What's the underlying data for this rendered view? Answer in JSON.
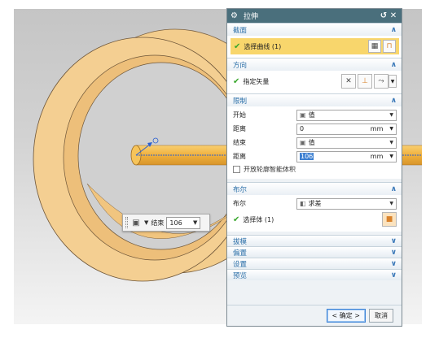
{
  "dialog": {
    "title": "拉伸",
    "sections": {
      "section": {
        "title": "截面",
        "select_curve": "选择曲线 (1)"
      },
      "direction": {
        "title": "方向",
        "specify_vector": "指定矢量"
      },
      "limits": {
        "title": "限制",
        "start_label": "开始",
        "start_type": "值",
        "start_distance_label": "距离",
        "start_distance": "0",
        "start_unit": "mm",
        "end_label": "结束",
        "end_type": "值",
        "end_distance_label": "距离",
        "end_distance": "106",
        "end_unit": "mm",
        "open_profile_label": "开放轮廓智能体积"
      },
      "boolean": {
        "title": "布尔",
        "boolean_label": "布尔",
        "boolean_value": "求差",
        "select_body": "选择体 (1)"
      },
      "collapsed": [
        "拔模",
        "偏置",
        "设置",
        "预览"
      ]
    },
    "buttons": {
      "ok": "< 确定 >",
      "cancel": "取消"
    }
  },
  "viewport_toolbar": {
    "label": "结束",
    "value": "106"
  },
  "colors": {
    "title_bar": "#4a6f7c",
    "section_title": "#2b6fa8",
    "highlight_row": "#f8d66c",
    "ring": "#f1c27a",
    "shaft": "#f2b64a"
  },
  "icons": [
    "gear-icon",
    "undo-icon",
    "close-icon",
    "check-icon",
    "chevron-up-icon",
    "chevron-down-icon",
    "cube-icon",
    "vector-icon"
  ]
}
